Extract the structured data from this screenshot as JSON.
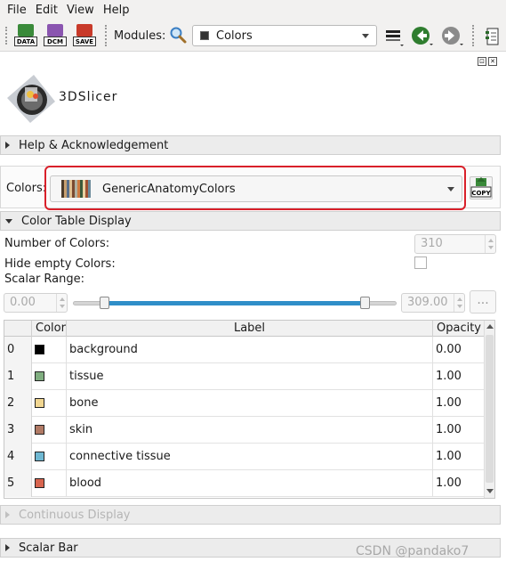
{
  "menu": {
    "file": "File",
    "edit": "Edit",
    "view": "View",
    "help": "Help"
  },
  "toolbar": {
    "data_label": "DATA",
    "dcm_label": "DCM",
    "save_label": "SAVE",
    "modules_label": "Modules:",
    "module_selected": "Colors"
  },
  "app": {
    "logo_text": "3DSlicer"
  },
  "sections": {
    "help": "Help & Acknowledgement",
    "color_table": "Color Table Display",
    "continuous": "Continuous Display",
    "scalar_bar": "Scalar Bar"
  },
  "colors": {
    "label": "Colors:",
    "selected": "GenericAnatomyColors",
    "copy_label": "COPY"
  },
  "display": {
    "num_colors_label": "Number of Colors:",
    "num_colors_value": "310",
    "hide_empty_label": "Hide empty Colors:",
    "scalar_range_label": "Scalar Range:",
    "range_min": "0.00",
    "range_max": "309.00",
    "more_label": "..."
  },
  "table": {
    "headers": {
      "index": "",
      "color": "Color",
      "label": "Label",
      "opacity": "Opacity"
    },
    "rows": [
      {
        "index": "0",
        "color": "#000000",
        "label": "background",
        "opacity": "0.00"
      },
      {
        "index": "1",
        "color": "#80ae80",
        "label": "tissue",
        "opacity": "1.00"
      },
      {
        "index": "2",
        "color": "#f1d691",
        "label": "bone",
        "opacity": "1.00"
      },
      {
        "index": "3",
        "color": "#b17a65",
        "label": "skin",
        "opacity": "1.00"
      },
      {
        "index": "4",
        "color": "#6fb8d2",
        "label": "connective tissue",
        "opacity": "1.00"
      },
      {
        "index": "5",
        "color": "#d8654f",
        "label": "blood",
        "opacity": "1.00"
      }
    ]
  },
  "watermark": "CSDN @pandako7",
  "colors_theme": {
    "highlight": "#d9202a",
    "slider": "#2f8ec8"
  }
}
